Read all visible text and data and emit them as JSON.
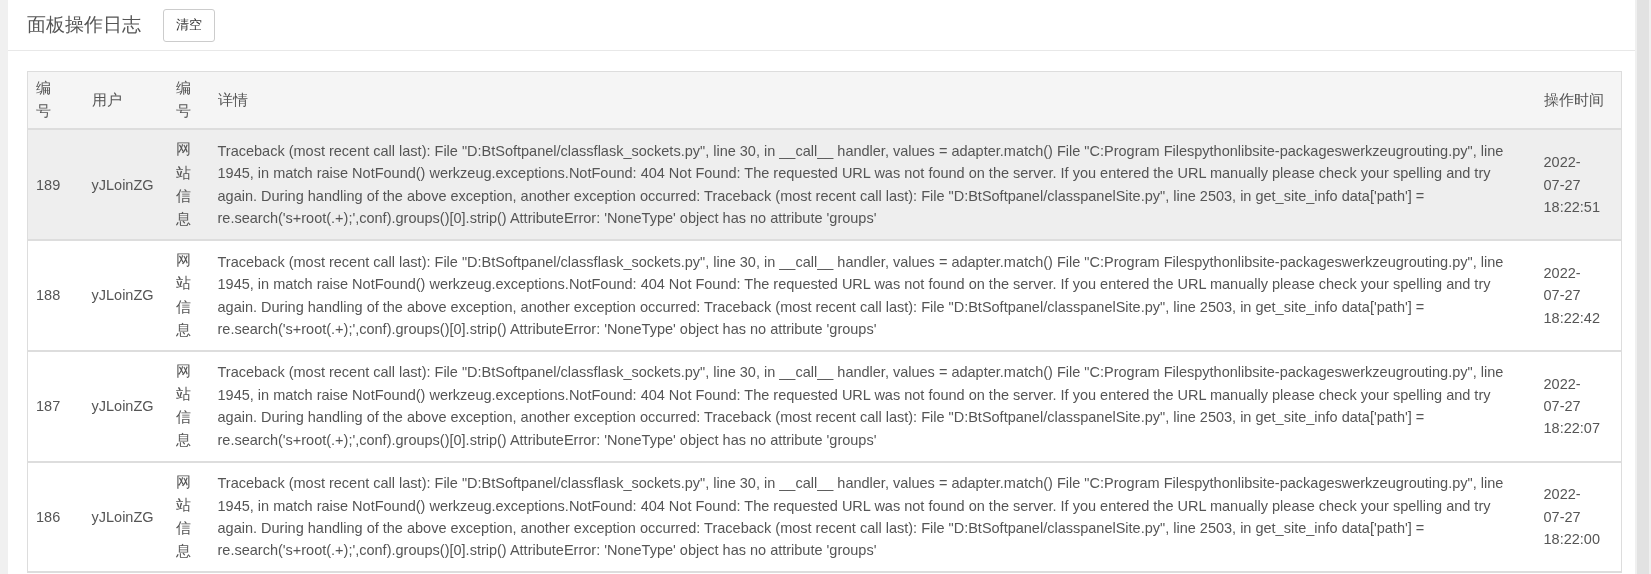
{
  "page": {
    "title": "面板操作日志",
    "clear_button": "清空"
  },
  "table": {
    "columns": [
      "编号",
      "用户",
      "编号",
      "详情",
      "操作时间"
    ],
    "rows": [
      {
        "selected": true,
        "cells": [
          "189",
          "yJLoinZG",
          "网站信息",
          "Traceback (most recent call last): File \"D:BtSoftpanel/classflask_sockets.py\", line 30, in __call__ handler, values = adapter.match() File \"C:Program Filespythonlibsite-packageswerkzeugrouting.py\", line 1945, in match raise NotFound() werkzeug.exceptions.NotFound: 404 Not Found: The requested URL was not found on the server. If you entered the URL manually please check your spelling and try again. During handling of the above exception, another exception occurred: Traceback (most recent call last): File \"D:BtSoftpanel/classpanelSite.py\", line 2503, in get_site_info data['path'] = re.search('s+root(.+);',conf).groups()[0].strip() AttributeError: 'NoneType' object has no attribute 'groups'",
          "2022-07-27 18:22:51"
        ]
      },
      {
        "selected": false,
        "cells": [
          "188",
          "yJLoinZG",
          "网站信息",
          "Traceback (most recent call last): File \"D:BtSoftpanel/classflask_sockets.py\", line 30, in __call__ handler, values = adapter.match() File \"C:Program Filespythonlibsite-packageswerkzeugrouting.py\", line 1945, in match raise NotFound() werkzeug.exceptions.NotFound: 404 Not Found: The requested URL was not found on the server. If you entered the URL manually please check your spelling and try again. During handling of the above exception, another exception occurred: Traceback (most recent call last): File \"D:BtSoftpanel/classpanelSite.py\", line 2503, in get_site_info data['path'] = re.search('s+root(.+);',conf).groups()[0].strip() AttributeError: 'NoneType' object has no attribute 'groups'",
          "2022-07-27 18:22:42"
        ]
      },
      {
        "selected": false,
        "cells": [
          "187",
          "yJLoinZG",
          "网站信息",
          "Traceback (most recent call last): File \"D:BtSoftpanel/classflask_sockets.py\", line 30, in __call__ handler, values = adapter.match() File \"C:Program Filespythonlibsite-packageswerkzeugrouting.py\", line 1945, in match raise NotFound() werkzeug.exceptions.NotFound: 404 Not Found: The requested URL was not found on the server. If you entered the URL manually please check your spelling and try again. During handling of the above exception, another exception occurred: Traceback (most recent call last): File \"D:BtSoftpanel/classpanelSite.py\", line 2503, in get_site_info data['path'] = re.search('s+root(.+);',conf).groups()[0].strip() AttributeError: 'NoneType' object has no attribute 'groups'",
          "2022-07-27 18:22:07"
        ]
      },
      {
        "selected": false,
        "cells": [
          "186",
          "yJLoinZG",
          "网站信息",
          "Traceback (most recent call last): File \"D:BtSoftpanel/classflask_sockets.py\", line 30, in __call__ handler, values = adapter.match() File \"C:Program Filespythonlibsite-packageswerkzeugrouting.py\", line 1945, in match raise NotFound() werkzeug.exceptions.NotFound: 404 Not Found: The requested URL was not found on the server. If you entered the URL manually please check your spelling and try again. During handling of the above exception, another exception occurred: Traceback (most recent call last): File \"D:BtSoftpanel/classpanelSite.py\", line 2503, in get_site_info data['path'] = re.search('s+root(.+);',conf).groups()[0].strip() AttributeError: 'NoneType' object has no attribute 'groups'",
          "2022-07-27 18:22:00"
        ]
      }
    ]
  }
}
